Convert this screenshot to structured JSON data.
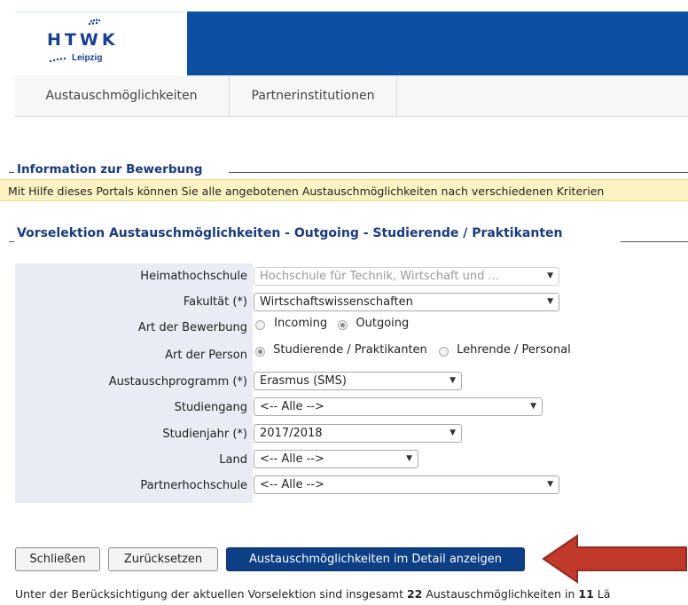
{
  "header": {
    "logo_letters": "HTWK",
    "logo_sub": "Leipzig"
  },
  "nav": {
    "items": [
      {
        "label": "Austauschmöglichkeiten"
      },
      {
        "label": "Partnerinstitutionen"
      }
    ]
  },
  "info": {
    "heading": "Information zur Bewerbung",
    "text": "Mit Hilfe dieses Portals können Sie alle angebotenen Austauschmöglichkeiten nach verschiedenen Kriterien"
  },
  "selection": {
    "heading": "Vorselektion Austauschmöglichkeiten - Outgoing - Studierende / Praktikanten"
  },
  "form": {
    "heimathochschule": {
      "label": "Heimathochschule",
      "value": "Hochschule für Technik, Wirtschaft und   ..."
    },
    "fakultaet": {
      "label": "Fakultät (*)",
      "value": "Wirtschaftswissenschaften"
    },
    "art_bewerbung": {
      "label": "Art der Bewerbung",
      "options": [
        "Incoming",
        "Outgoing"
      ],
      "selected": "Outgoing"
    },
    "art_person": {
      "label": "Art der Person",
      "options": [
        "Studierende / Praktikanten",
        "Lehrende / Personal"
      ],
      "selected": "Studierende / Praktikanten"
    },
    "austauschprogramm": {
      "label": "Austauschprogramm (*)",
      "value": "Erasmus (SMS)"
    },
    "studiengang": {
      "label": "Studiengang",
      "value": "<-- Alle -->"
    },
    "studienjahr": {
      "label": "Studienjahr (*)",
      "value": "2017/2018"
    },
    "land": {
      "label": "Land",
      "value": "<-- Alle -->"
    },
    "partnerhochschule": {
      "label": "Partnerhochschule",
      "value": "<-- Alle -->"
    }
  },
  "buttons": {
    "close": "Schließen",
    "reset": "Zurücksetzen",
    "details": "Austauschmöglichkeiten im Detail anzeigen"
  },
  "summary": {
    "prefix": "Unter der Berücksichtigung der aktuellen Vorselektion sind insgesamt ",
    "count": "22",
    "middle": " Austauschmöglichkeiten in ",
    "countries": "11",
    "suffix": " Lä"
  },
  "colors": {
    "brand_blue": "#0d4fa3",
    "button_blue": "#0d3f86",
    "info_bg": "#fdf3c2",
    "arrow_red": "#c0392b"
  }
}
